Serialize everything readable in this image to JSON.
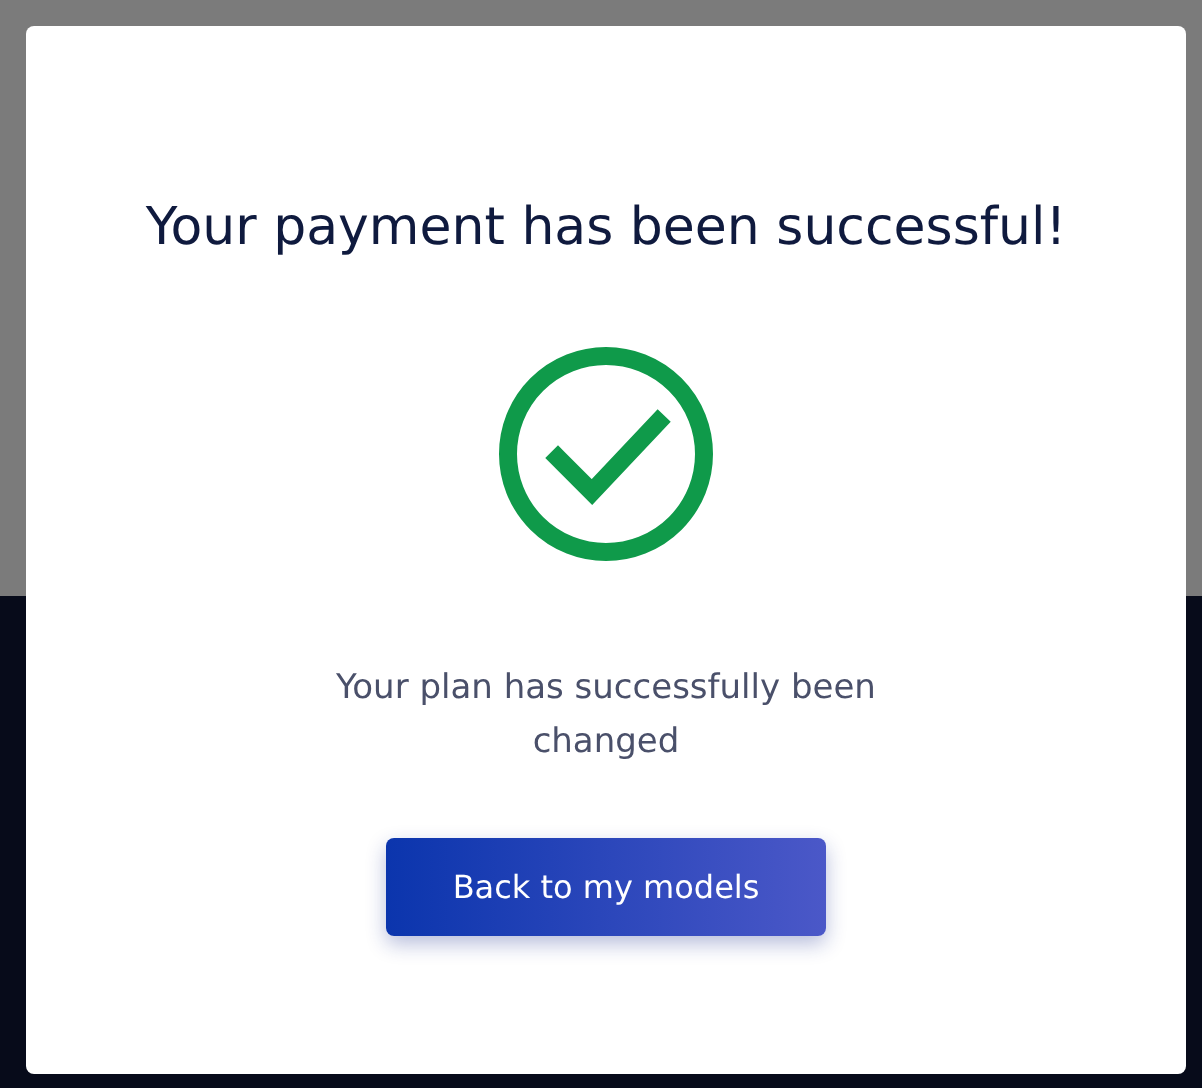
{
  "dialog": {
    "title": "Your payment has been successful!",
    "kind": "success",
    "message": "Your plan has successfully been changed",
    "button": "Back to my models"
  }
}
